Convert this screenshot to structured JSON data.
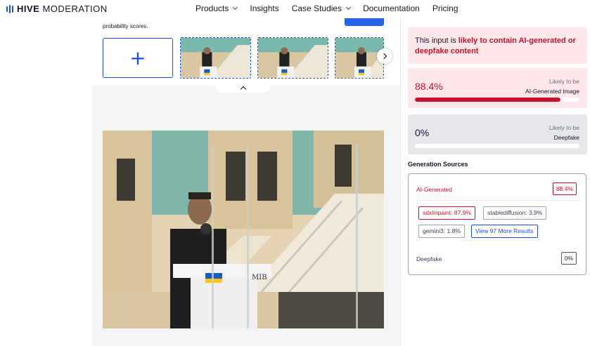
{
  "brand": {
    "name_bold": "HIVE",
    "name_rest": "MODERATION"
  },
  "nav": {
    "items": [
      {
        "label": "Products",
        "has_dropdown": true
      },
      {
        "label": "Insights",
        "has_dropdown": false
      },
      {
        "label": "Case Studies",
        "has_dropdown": true
      },
      {
        "label": "Documentation",
        "has_dropdown": false
      },
      {
        "label": "Pricing",
        "has_dropdown": false
      }
    ]
  },
  "upload_panel": {
    "hint_text": "probability scores.",
    "add_icon": "plus-icon",
    "next_icon": "chevron-right-icon",
    "collapse_icon": "chevron-up-icon",
    "thumbnail_count": 3
  },
  "result": {
    "alert_prefix": "This input is ",
    "alert_emphasis": "likely to contain AI-generated or deepfake content",
    "ai_score": {
      "value": "88.4%",
      "label_line1": "Likely to be",
      "label_line2": "AI-Generated Image",
      "fraction": 0.884
    },
    "deepfake_score": {
      "value": "0%",
      "label_line1": "Likely to be",
      "label_line2": "Deepfake",
      "fraction": 0
    }
  },
  "generation_sources": {
    "title": "Generation Sources",
    "ai_generated_label": "AI-Generated",
    "ai_generated_value": "88.4%",
    "sources": [
      {
        "label": "sdxlinpaint: 87.9%"
      },
      {
        "label": "stablediffusion: 3.9%"
      },
      {
        "label": "gemini3: 1.8%"
      }
    ],
    "more_results_label": "View 97 More Results",
    "deepfake_label": "Deepfake",
    "deepfake_value": "0%"
  },
  "colors": {
    "accent_blue": "#1d4ed8",
    "alert_red": "#c8102e",
    "alert_bg": "#fde7e9"
  }
}
